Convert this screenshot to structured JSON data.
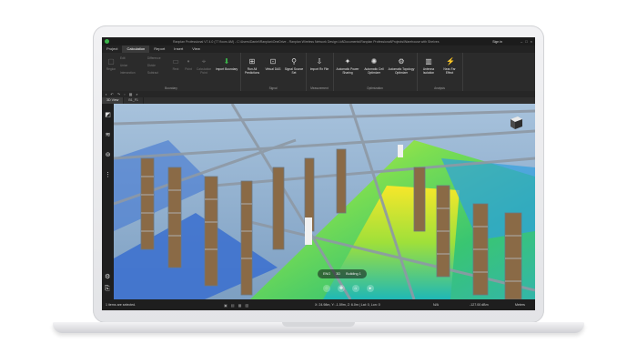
{
  "window": {
    "title": "Ranplan Professional V7.4.0 (77 floors AM) - C:\\Users\\Daniel\\Ranplan\\OneDrive - Ranplan Wireless Network Design Ltd\\Documents\\Ranplan Professional\\Projects\\Warehouse with Shelves",
    "sign_in": "Sign in"
  },
  "menu": {
    "tabs": [
      "Project",
      "Calculation",
      "Report",
      "Insert",
      "View"
    ],
    "active": "Calculation"
  },
  "ribbon": {
    "boundary_group": {
      "label": "Boundary",
      "small_left": [
        "Region",
        "Edit",
        "Union",
        "Intersection",
        "Difference",
        "Divide",
        "Subtract"
      ],
      "buttons": [
        "Rect",
        "Point",
        "Calculation Point"
      ],
      "import_label": "Import Boundary"
    },
    "signal_group": {
      "label": "Signal",
      "buttons": [
        "Run All Predictions",
        "Virtual DAS",
        "Signal Source Set"
      ]
    },
    "measurement_group": {
      "label": "Measurement",
      "buttons": [
        "Import Rx File"
      ]
    },
    "optimization_group": {
      "label": "Optimization",
      "buttons": [
        "Automatic Power Sharing",
        "Automatic Cell Optimizer",
        "Automatic Topology Optimizer"
      ]
    },
    "analysis_group": {
      "label": "Analysis",
      "buttons": [
        "Antenna Isolation",
        "Near-Far Effect"
      ]
    }
  },
  "view_tabs": {
    "primary": "3D View",
    "secondary": "B1_F1"
  },
  "viewport": {
    "hud_floor": "ENG",
    "hud_level": "3D",
    "hud_building": "Building 1"
  },
  "status": {
    "selection": "1 items are selected.",
    "coordinates": "X: 24.98m, Y: -1.59m, Z: 6.0m | Lat: 0, Lon: 0",
    "na": "N/A",
    "dbm": "-127.00 dBm",
    "units": "Meters"
  }
}
